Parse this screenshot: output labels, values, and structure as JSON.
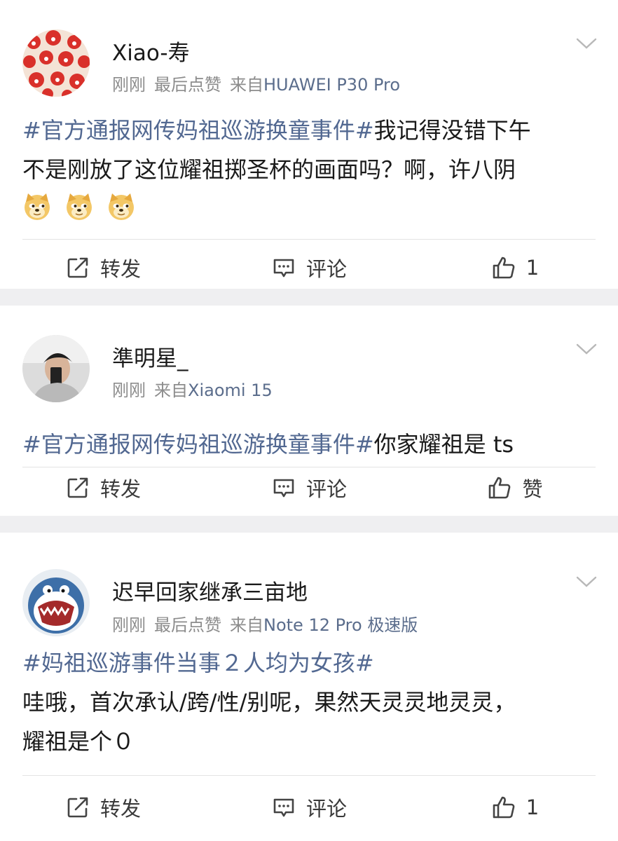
{
  "posts": [
    {
      "username": "Xiao-寿",
      "time": "刚刚",
      "liked_status": "最后点赞",
      "source_prefix": "来自",
      "device": "HUAWEI P30 Pro",
      "hashtag": "#官方通报网传妈祖巡游换童事件#",
      "body_line1": "我记得没错下午",
      "body_line2": "不是刚放了这位耀祖掷圣杯的画面吗？啊，许八阴",
      "emojis": [
        "doge-emoji",
        "doge-emoji",
        "doge-emoji"
      ],
      "actions": {
        "repost": "转发",
        "comment": "评论",
        "like": "1"
      }
    },
    {
      "username": "準明星_",
      "time": "刚刚",
      "source_prefix": "来自",
      "device": "Xiaomi 15",
      "hashtag": "#官方通报网传妈祖巡游换童事件#",
      "body": "你家耀祖是 ts",
      "actions": {
        "repost": "转发",
        "comment": "评论",
        "like": "赞"
      }
    },
    {
      "username": "迟早回家继承三亩地",
      "time": "刚刚",
      "liked_status": "最后点赞",
      "source_prefix": "来自",
      "device": "Note 12 Pro 极速版",
      "hashtag": "#妈祖巡游事件当事２人均为女孩#",
      "body_line1": "哇哦，首次承认/跨/性/别呢，果然天灵灵地灵灵，",
      "body_line2": "耀祖是个０",
      "actions": {
        "repost": "转发",
        "comment": "评论",
        "like": "1"
      }
    }
  ],
  "colors": {
    "hashtag": "#526891",
    "device": "#5b6d8c",
    "meta": "#8c8c8c",
    "background": "#efeff1"
  }
}
